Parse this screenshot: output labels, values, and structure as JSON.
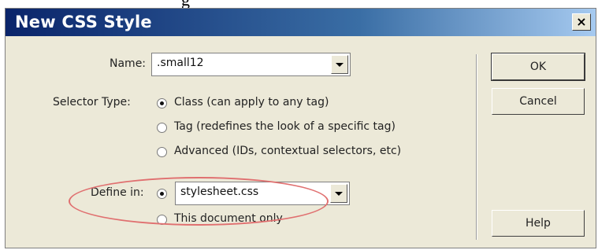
{
  "caption_fragment": "g",
  "dialog": {
    "title": "New CSS Style",
    "close_label": "×"
  },
  "name": {
    "label": "Name:",
    "value": ".small12"
  },
  "selector_type": {
    "label": "Selector Type:",
    "options": [
      {
        "label": "Class (can apply to any tag)",
        "checked": true
      },
      {
        "label": "Tag (redefines the look of a specific tag)",
        "checked": false
      },
      {
        "label": "Advanced (IDs, contextual selectors, etc)",
        "checked": false
      }
    ]
  },
  "define_in": {
    "label": "Define in:",
    "stylesheet_value": "stylesheet.css",
    "this_document_label": "This document only",
    "stylesheet_checked": true
  },
  "buttons": {
    "ok": "OK",
    "cancel": "Cancel",
    "help": "Help"
  },
  "colors": {
    "titlebar_start": "#0a246a",
    "titlebar_end": "#a6caf0",
    "dialog_bg": "#ece9d8",
    "highlight": "#e07070"
  }
}
